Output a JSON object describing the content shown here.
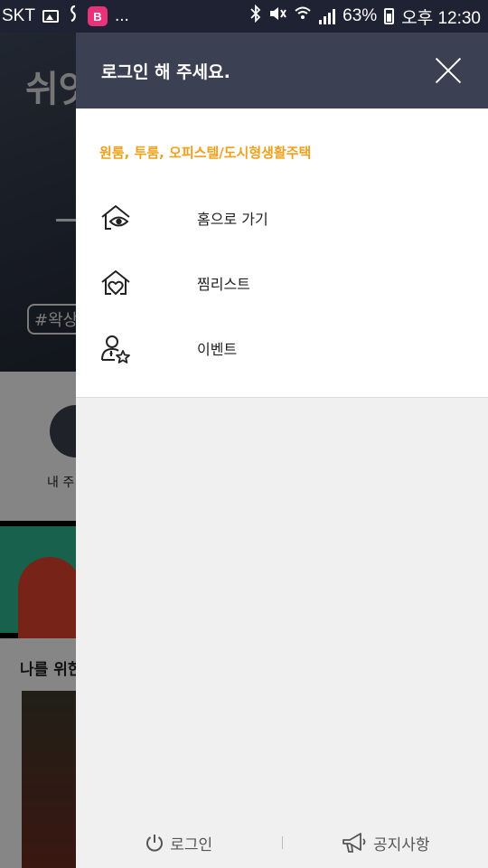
{
  "status_bar": {
    "carrier": "SKT",
    "more": "...",
    "app_badge": "B",
    "battery": "63%",
    "time": "오후 12:30"
  },
  "background": {
    "hero_title": "쉬엇",
    "hero_tag": "#왁상",
    "circle_label": "내 주",
    "section_title": "나를 위한"
  },
  "drawer": {
    "header_title": "로그인 해 주세요.",
    "category": "원룸, 투룸, 오피스텔/도시형생활주택",
    "items": [
      {
        "label": "홈으로 가기",
        "icon": "home-eye-icon"
      },
      {
        "label": "찜리스트",
        "icon": "home-heart-icon"
      },
      {
        "label": "이벤트",
        "icon": "user-star-icon"
      }
    ],
    "footer": {
      "login_label": "로그인",
      "notice_label": "공지사항"
    }
  },
  "colors": {
    "header_bg": "#3b4053",
    "accent": "#f0a01c",
    "status_bar_bg": "#1f2233"
  }
}
